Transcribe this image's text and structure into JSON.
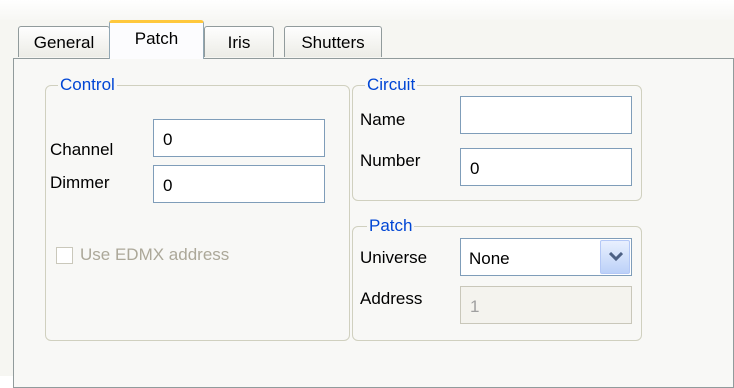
{
  "tabs": [
    "General",
    "Patch",
    "Iris",
    "Shutters"
  ],
  "active_tab": "Patch",
  "control": {
    "legend": "Control",
    "channel_label": "Channel",
    "channel_value": "0",
    "dimmer_label": "Dimmer",
    "dimmer_value": "0",
    "edmx_label": "Use EDMX address",
    "edmx_checked": false
  },
  "circuit": {
    "legend": "Circuit",
    "name_label": "Name",
    "name_value": "",
    "number_label": "Number",
    "number_value": "0"
  },
  "patch": {
    "legend": "Patch",
    "universe_label": "Universe",
    "universe_value": "None",
    "address_label": "Address",
    "address_value": "1"
  }
}
